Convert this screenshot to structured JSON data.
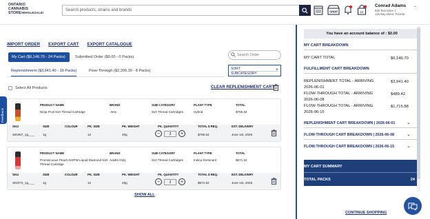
{
  "header": {
    "logo_lines": [
      "ONTARIO",
      "CANNABIS",
      "STORE"
    ],
    "logo_suffix": "/WHOLESALE/",
    "search_placeholder": "Search products, strains and brands",
    "shop_label": "SHOP",
    "cart_count": "24",
    "user": {
      "name": "Conrad Adams",
      "address_line1": "828 Test Store 1",
      "address_line2": "126 Bay street, Toronto"
    },
    "icons": [
      "search-icon",
      "catalogue-icon",
      "shop-icon",
      "notification-icon",
      "cart-icon",
      "chevron-down-icon"
    ]
  },
  "top_links": [
    "IMPORT ORDER",
    "EXPORT CART",
    "EXPORT CATALOGUE"
  ],
  "main_tabs": [
    {
      "label": "My Cart ($6,146.70 - 24 Packs)",
      "active": true
    },
    {
      "label": "Submitted Order ($0.00 - 0 Packs)",
      "active": false
    }
  ],
  "order_search_placeholder": "Search Order",
  "sub_tabs": [
    {
      "label": "Replenishment ($3,941.40 - 16 Packs)",
      "active": true
    },
    {
      "label": "Flow-Through ($2,205.30 - 8 Packs)",
      "active": false
    }
  ],
  "sort": {
    "label": "SORT",
    "value": "SUBCATEGORY"
  },
  "select_all_label": "Select All Products",
  "clear_label": "CLEAR REPLENISHMENT CART",
  "columns_top": [
    "PRODUCT NAME",
    "BRAND",
    "SUB CATEGORY",
    "PLANT TYPE",
    "TOTAL"
  ],
  "columns_bottom": [
    "SKU",
    "SIZE",
    "COLOUR",
    "PK. SIZE",
    "PK. WEIGHT",
    "PK. QUANTITY",
    "TOTAL $ REQ.",
    "EST. DELIVERY"
  ],
  "items": [
    {
      "product_name": "Ninja Fruit 510 Thread Cartridge",
      "brand": "-/ess",
      "sub_category": "510 Thread Cartridges",
      "plant_type": "Hybrid",
      "total": "$755.64",
      "sku": "300467_1g,___",
      "size": "1g",
      "colour": "",
      "pk_size": "12",
      "pk_weight": "48g",
      "quantity": "3",
      "total_req": "$755.64",
      "est_delivery": "June 1st, 2026",
      "image_color": "#c8502c"
    },
    {
      "product_name": "Promiscuous Peach NSPW Liquid Diamond 510 Thread Cartridge",
      "brand": "Adults Only",
      "sub_category": "510 Thread Cartridges",
      "plant_type": "Indica Dominant",
      "total": "$671.52",
      "sku": "302072_1g,___",
      "size": "1g",
      "colour": "",
      "pk_size": "12",
      "pk_weight": "48g",
      "quantity": "2",
      "total_req": "$671.52",
      "est_delivery": "June 1st, 2026",
      "image_color": "#d23a3a"
    }
  ],
  "show_all_label": "SHOW ALL",
  "feedback_label": "Feedback",
  "panel": {
    "balance_text": "You have an account balance of : $0.00",
    "breakdown_title": "MY CART BREAKDOWN",
    "cart_total_label": "MY CART TOTAL",
    "cart_total_value": "$6,146.70",
    "fulfillment_title": "FULFILLMENT CART BREAKDOWN",
    "fulfillment_rows": [
      {
        "label": "REPLENISHMENT TOTAL - ARRIVING 2026-06-01",
        "value": "$3,941.40"
      },
      {
        "label": "FLOW-THROUGH TOTAL - ARRIVING 2026-06-08",
        "value": "$489.42"
      },
      {
        "label": "FLOW-THROUGH TOTAL - ARRIVING 2026-06-15",
        "value": "$1,715.88"
      }
    ],
    "breakdowns": [
      "REPLENISHMENT CART BREAKDOWN | 2026-06-01",
      "FLOW-THROUGH CART BREAKDOWN | 2026-06-08",
      "FLOW-THROUGH CART BREAKDOWN | 2026-06-15"
    ],
    "summary_title": "MY CART SUMMARY",
    "total_packs_label": "TOTAL PACKS",
    "total_packs_value": "24",
    "continue_label": "CONTINUE SHOPPING"
  },
  "colors": {
    "brand_navy": "#1b2340",
    "accent_blue": "#1e4f9c",
    "summary_bg": "#1e3f7a"
  }
}
